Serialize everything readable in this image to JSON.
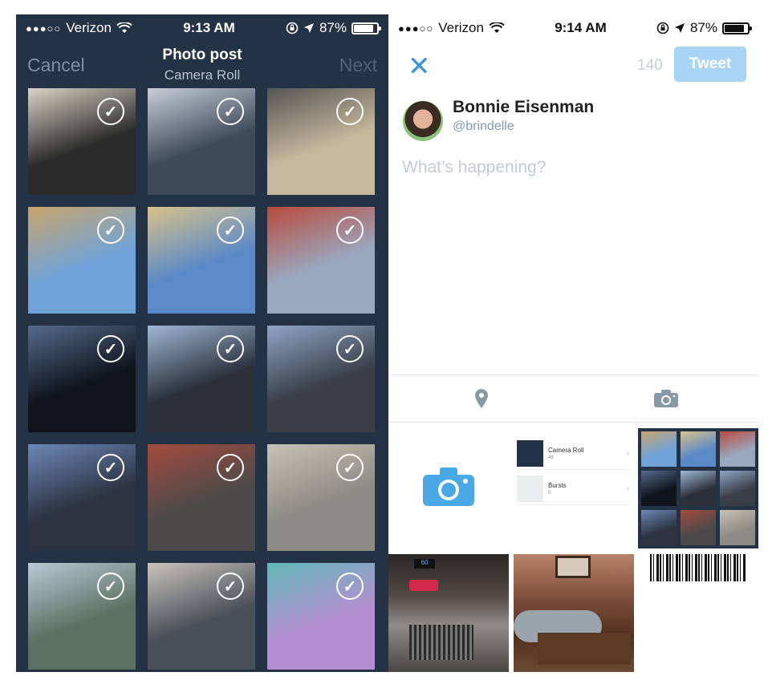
{
  "left_screen": {
    "status": {
      "carrier": "Verizon",
      "time": "9:13 AM",
      "battery": "87%",
      "signal_dots": "●●●○○"
    },
    "nav": {
      "cancel": "Cancel",
      "title": "Photo post",
      "subtitle": "Camera Roll",
      "next": "Next"
    },
    "grid": {
      "selected_count": 15,
      "check_glyph": "✓",
      "tiles": [
        {
          "bg": "#2b2b2b",
          "accent": "#d9d4c7"
        },
        {
          "bg": "#3e4a5a",
          "accent": "#c9cfd9"
        },
        {
          "bg": "#c7b79c",
          "accent": "#555555"
        },
        {
          "bg": "#6fa3d9",
          "accent": "#c9a46c"
        },
        {
          "bg": "#5a89c8",
          "accent": "#d8c28a"
        },
        {
          "bg": "#9aa8c0",
          "accent": "#b94a3c"
        },
        {
          "bg": "#0f141c",
          "accent": "#556b8c"
        },
        {
          "bg": "#2a2f3a",
          "accent": "#9fb8d6"
        },
        {
          "bg": "#3a3e48",
          "accent": "#8ea6c6"
        },
        {
          "bg": "#2c3240",
          "accent": "#6c88b8"
        },
        {
          "bg": "#4b4a49",
          "accent": "#a44b3e"
        },
        {
          "bg": "#8c8b85",
          "accent": "#c8c2b6"
        },
        {
          "bg": "#5d7162",
          "accent": "#b9c9d6"
        },
        {
          "bg": "#4a5058",
          "accent": "#c9c4bd"
        },
        {
          "bg": "#b38fd1",
          "accent": "#62b8b6"
        }
      ]
    }
  },
  "right_screen": {
    "status": {
      "carrier": "Verizon",
      "time": "9:14 AM",
      "battery": "87%",
      "signal_dots": "●●●○○"
    },
    "compose": {
      "close_glyph": "✕",
      "char_count": "140",
      "tweet_button": "Tweet",
      "user_name": "Bonnie Eisenman",
      "user_handle": "@brindelle",
      "placeholder": "What’s happening?"
    },
    "toolbar": {
      "icons": [
        "location-pin-icon",
        "camera-icon"
      ]
    },
    "media": {
      "albums": [
        {
          "name": "Camera Roll",
          "count": "49"
        },
        {
          "name": "Bursts",
          "count": "0"
        }
      ],
      "chevron": "›",
      "coffee_display": "60"
    }
  },
  "colors": {
    "dark_bg": "#243246",
    "twitter_blue": "#3b94d9",
    "tweet_button_disabled": "#a9d4f5",
    "camera_tile": "#48a9e6"
  }
}
